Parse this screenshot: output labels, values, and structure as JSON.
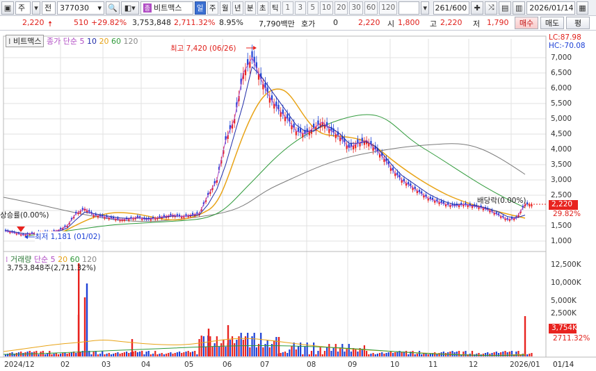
{
  "toolbar": {
    "market": "주",
    "mode": "전",
    "code": "377030",
    "name_badge": "종",
    "name": "비트맥스",
    "periods": [
      "일",
      "주",
      "월",
      "년",
      "분",
      "초",
      "틱"
    ],
    "active_period": "일",
    "intervals": [
      "1",
      "3",
      "5",
      "10",
      "20",
      "30",
      "60",
      "120"
    ],
    "count": "261",
    "count_total": "/600",
    "date": "2026/01/14"
  },
  "quote": {
    "price": "2,220",
    "change": "510",
    "change_pct": "+29.82%",
    "volume": "3,753,848",
    "vol_pct": "2,711.32%",
    "turnover": "8.95%",
    "amount": "7,790백만",
    "hoga_label": "호가",
    "hoga": "0",
    "hoga_price": "2,220",
    "open_label": "시",
    "open": "1,800",
    "high_label": "고",
    "high": "2,220",
    "low_label": "저",
    "low": "1,790",
    "buy": "매수",
    "sell": "매도",
    "eval": "평"
  },
  "price_panel": {
    "name_tag": "비트맥스",
    "ma_label": "종가 단순",
    "ma": [
      "5",
      "10",
      "20",
      "60",
      "120"
    ],
    "lc": "LC:87.98",
    "hc": "HC:-70.08",
    "high_note": "최고 7,420 (06/26)",
    "low_note": "최저 1,181 (01/02)",
    "left_note": "상승률(0.00%)",
    "div_note": "배당락(0.00%)",
    "y_labels": [
      "7,000",
      "6,500",
      "6,000",
      "5,500",
      "5,000",
      "4,500",
      "4,000",
      "3,500",
      "3,000",
      "2,500",
      "1,500",
      "1,000"
    ],
    "cur_label": "2,220",
    "cur_pct": "29.82%"
  },
  "volume_panel": {
    "title": "거래량",
    "ma_label": "단순",
    "ma": [
      "5",
      "20",
      "60",
      "120"
    ],
    "info": "3,753,848주(2,711.32%)",
    "y_labels": [
      "12,500K",
      "10,000K",
      "5,000K",
      "2,500K"
    ],
    "cur_label": "3,754K",
    "cur_pct": "2711.32%"
  },
  "x_labels": [
    "2024/12",
    "02",
    "03",
    "04",
    "05",
    "06",
    "07",
    "08",
    "09",
    "10",
    "11",
    "12",
    "2026/01"
  ],
  "x_date": "01/14",
  "colors": {
    "up": "#e8231f",
    "down": "#1e42d6",
    "ma5": "#b04cc4",
    "ma10": "#1e2aa8",
    "ma20": "#e8a316",
    "ma60": "#2f9a3a",
    "ma120": "#7a7a7a"
  },
  "chart_data": {
    "type": "line",
    "series": [
      {
        "name": "5",
        "values": [
          1330,
          1270,
          1200,
          1250,
          1300,
          1290,
          1350,
          1500,
          1900,
          2060,
          1850,
          1800,
          1750,
          1700,
          1720,
          1780,
          1700,
          1750,
          1800,
          1850,
          1800,
          1850,
          1900,
          2500,
          3000,
          4300,
          5000,
          6500,
          7000,
          6300,
          5700,
          5300,
          5000,
          4600,
          4500,
          4700,
          4900,
          4600,
          4400,
          4050,
          4200,
          4300,
          4000,
          3700,
          3300,
          3000,
          2800,
          2600,
          2400,
          2300,
          2200,
          2150,
          2200,
          2150,
          2100,
          2000,
          1850,
          1700,
          1750,
          2200
        ]
      },
      {
        "name": "10",
        "values": [
          1350,
          1300,
          1250,
          1240,
          1270,
          1280,
          1320,
          1420,
          1700,
          1950,
          1900,
          1850,
          1800,
          1760,
          1740,
          1760,
          1740,
          1750,
          1780,
          1820,
          1810,
          1830,
          1860,
          2200,
          2700,
          3500,
          4500,
          5500,
          6700,
          6400,
          6000,
          5600,
          5200,
          4800,
          4600,
          4600,
          4800,
          4700,
          4500,
          4200,
          4200,
          4250,
          4100,
          3800,
          3450,
          3150,
          2950,
          2750,
          2550,
          2400,
          2280,
          2200,
          2200,
          2170,
          2120,
          2050,
          1950,
          1800,
          1760,
          1850
        ]
      }
    ]
  }
}
